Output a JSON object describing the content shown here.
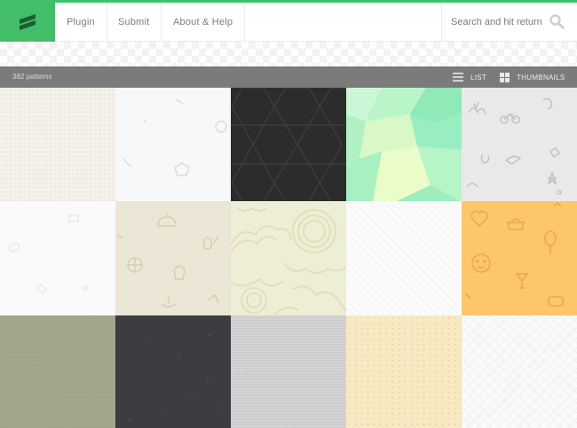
{
  "header": {
    "nav": [
      "Plugin",
      "Submit",
      "About & Help"
    ],
    "search_placeholder": "Search and hit return",
    "accent_color": "#43bd68"
  },
  "toolbar": {
    "pattern_count": "382 patterns",
    "list_label": "LIST",
    "thumbnails_label": "THUMBNAILS"
  },
  "patterns": [
    {
      "name": "light-beige-dots-pattern",
      "color": "#f4f1ea"
    },
    {
      "name": "white-geometric-shapes-pattern",
      "color": "#f7f8fa"
    },
    {
      "name": "dark-hexagon-pattern",
      "color": "#2c2c2c"
    },
    {
      "name": "green-polygon-pattern",
      "color": "#a4efc5"
    },
    {
      "name": "grey-doodle-icons-pattern",
      "color": "#e9e9e9"
    },
    {
      "name": "white-food-icons-pattern",
      "color": "#fafafa"
    },
    {
      "name": "beige-kitchen-icons-pattern",
      "color": "#ebe6d6"
    },
    {
      "name": "cream-cloud-doodle-pattern",
      "color": "#eeedd5"
    },
    {
      "name": "white-diagonal-lines-pattern",
      "color": "#fbfbfb"
    },
    {
      "name": "orange-party-icons-pattern",
      "color": "#fdc66a"
    },
    {
      "name": "olive-linen-texture",
      "color": "#9ea58b"
    },
    {
      "name": "dark-speckle-pattern",
      "color": "#3c3c43"
    },
    {
      "name": "grey-fabric-texture",
      "color": "#cfcfcf"
    },
    {
      "name": "sand-speckle-pattern",
      "color": "#f9e9c3"
    },
    {
      "name": "white-lattice-pattern",
      "color": "#fafafa"
    }
  ]
}
